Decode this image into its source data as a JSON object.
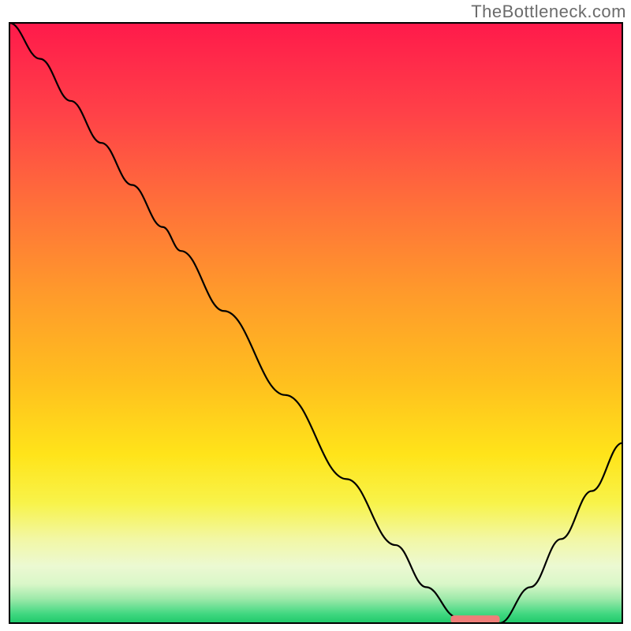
{
  "watermark": "TheBottleneck.com",
  "chart_data": {
    "type": "line",
    "title": "",
    "xlabel": "",
    "ylabel": "",
    "xlim": [
      0,
      100
    ],
    "ylim": [
      0,
      100
    ],
    "series": [
      {
        "name": "bottleneck-curve",
        "x": [
          0,
          5,
          10,
          15,
          20,
          25,
          28,
          35,
          45,
          55,
          63,
          68,
          73,
          76,
          80,
          85,
          90,
          95,
          100
        ],
        "y": [
          100,
          94,
          87,
          80,
          73,
          66,
          62,
          52,
          38,
          24,
          13,
          6,
          1,
          0,
          0,
          6,
          14,
          22,
          30
        ]
      }
    ],
    "flat_segment": {
      "x_start": 73,
      "x_end": 80,
      "y": 0
    },
    "optimal_marker": {
      "x_start": 72,
      "x_end": 80,
      "y": 0.5,
      "color": "#ef7e79"
    },
    "background_gradient": {
      "stops": [
        {
          "offset": 0.0,
          "color": "#ff1a4b"
        },
        {
          "offset": 0.15,
          "color": "#ff4148"
        },
        {
          "offset": 0.3,
          "color": "#ff6f3a"
        },
        {
          "offset": 0.45,
          "color": "#ff9a2b"
        },
        {
          "offset": 0.6,
          "color": "#ffc01e"
        },
        {
          "offset": 0.72,
          "color": "#ffe41a"
        },
        {
          "offset": 0.8,
          "color": "#f8f34a"
        },
        {
          "offset": 0.86,
          "color": "#f2f7a5"
        },
        {
          "offset": 0.905,
          "color": "#ecf9d2"
        },
        {
          "offset": 0.935,
          "color": "#d9f7c8"
        },
        {
          "offset": 0.96,
          "color": "#9ce9a9"
        },
        {
          "offset": 0.985,
          "color": "#3fd780"
        },
        {
          "offset": 1.0,
          "color": "#1fc96a"
        }
      ]
    },
    "frame_color": "#000000",
    "frame_width": 2
  }
}
